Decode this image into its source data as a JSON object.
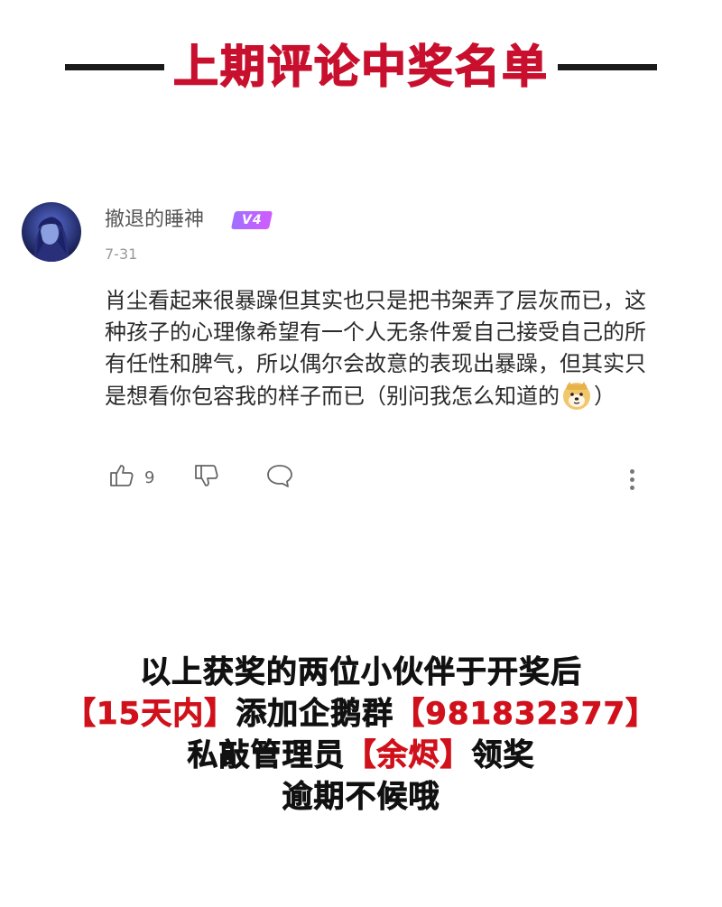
{
  "header": {
    "title": "上期评论中奖名单"
  },
  "comment": {
    "username": "撤退的睡神",
    "badge": "V4",
    "date": "7-31",
    "text": "肖尘看起来很暴躁但其实也只是把书架弄了层灰而已，这种孩子的心理像希望有一个人无条件爱自己接受自己的所有任性和脾气，所以偶尔会故意的表现出暴躁，但其实只是想看你包容我的样子而已（别问我怎么知道的",
    "text_end": "）",
    "emoji": "doge-emoji",
    "likes": "9",
    "icons": [
      "thumbs-up-icon",
      "thumbs-down-icon",
      "comment-bubble-icon",
      "more-vertical-icon"
    ]
  },
  "notice": {
    "line1": "以上获奖的两位小伙伴于开奖后",
    "line2_red1": "【15天内】",
    "line2_mid": "添加企鹅群",
    "line2_red2": "【981832377】",
    "line3_pre": "私敲管理员",
    "line3_red": "【余烬】",
    "line3_post": "领奖",
    "line4": "逾期不候哦"
  },
  "colors": {
    "title_red": "#c8102e",
    "notice_red": "#d0111b",
    "badge": "#b066ff"
  }
}
